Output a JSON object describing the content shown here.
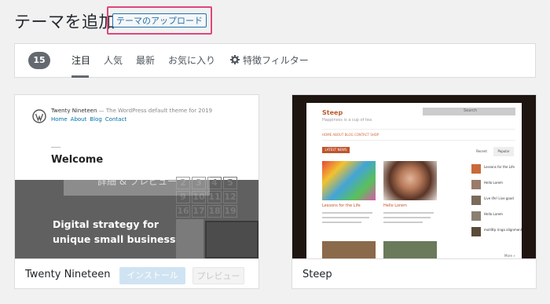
{
  "header": {
    "title": "テーマを追加",
    "upload_label": "テーマのアップロード",
    "highlight_color": "#e0457b"
  },
  "filter": {
    "count": "15",
    "tabs": [
      "注目",
      "人気",
      "最新",
      "お気に入り"
    ],
    "feature_filter": "特徴フィルター",
    "active_tab": "注目"
  },
  "themes": [
    {
      "name": "Twenty Nineteen",
      "preview": {
        "site_title": "Twenty Nineteen",
        "tagline": "— The WordPress default theme for 2019",
        "nav": [
          "Home",
          "About",
          "Blog",
          "Contact"
        ],
        "welcome": "Welcome",
        "hero_line1": "Digital strategy for",
        "hero_line2": "unique small businesses",
        "overlay_button": "詳細 & プレビュー",
        "calendar": [
          "2",
          "3",
          "4",
          "5",
          "9",
          "10",
          "11",
          "12",
          "16",
          "17",
          "18",
          "19"
        ]
      },
      "install_label": "インストール",
      "preview_label": "プレビュー"
    },
    {
      "name": "Steep",
      "preview": {
        "site_title": "Steep",
        "tagline": "Happiness is a cup of tea",
        "search": "Search",
        "nav": "HOME   ABOUT   BLOG   CONTACT   SHOP",
        "latest": "LATEST NEWS",
        "tabs": [
          "Recent",
          "Popular"
        ],
        "posts": [
          "Lessons for the Life",
          "Hello Lorem"
        ],
        "sidebar": [
          "Lessons for the Life",
          "Hello Lorem",
          "Live life! Live good",
          "Hello Lorem",
          "mollittp ringo alignment"
        ],
        "more": "More »"
      }
    }
  ]
}
